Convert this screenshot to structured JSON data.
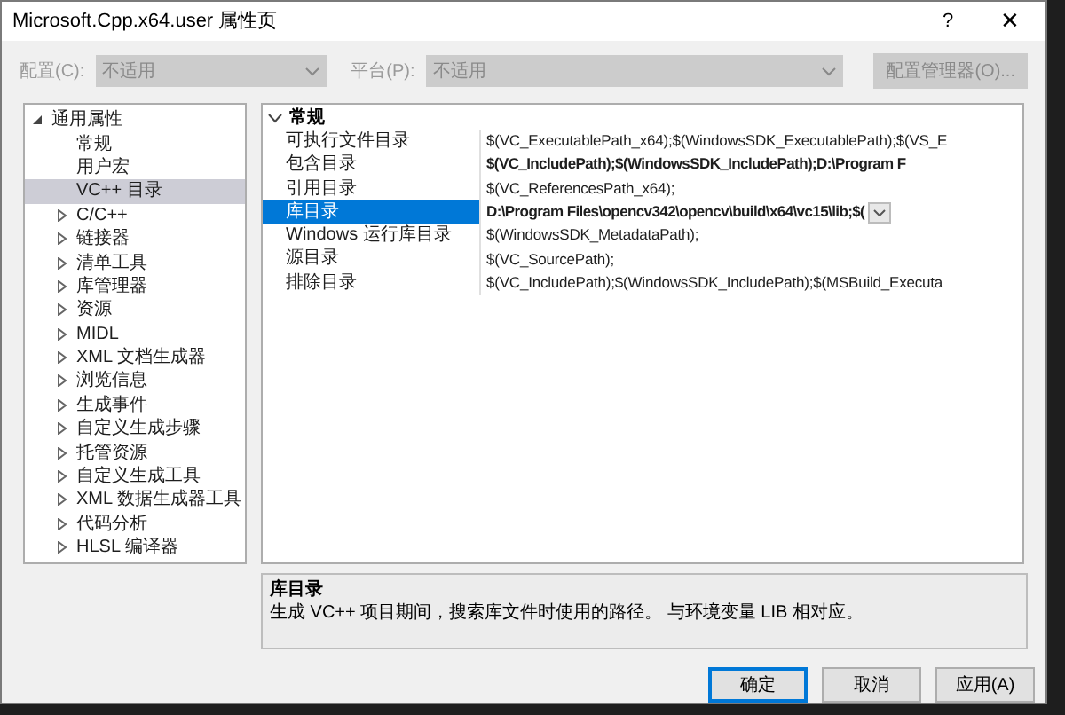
{
  "window": {
    "title": "Microsoft.Cpp.x64.user 属性页",
    "help": "?",
    "close": "✕"
  },
  "config": {
    "label": "配置(C):",
    "value": "不适用",
    "disabled": true
  },
  "platform": {
    "label": "平台(P):",
    "value": "不适用",
    "disabled": true
  },
  "config_manager_button": {
    "label": "配置管理器(O)...",
    "disabled": true
  },
  "tree": [
    {
      "label": "通用属性",
      "expanded": true,
      "selected": false,
      "children": [
        {
          "label": "常规",
          "selected": false
        },
        {
          "label": "用户宏",
          "selected": false
        },
        {
          "label": "VC++ 目录",
          "selected": true
        },
        {
          "label": "C/C++",
          "selected": false,
          "expanded": false
        },
        {
          "label": "链接器",
          "selected": false,
          "expanded": false
        },
        {
          "label": "清单工具",
          "selected": false,
          "expanded": false
        },
        {
          "label": "库管理器",
          "selected": false,
          "expanded": false
        },
        {
          "label": "资源",
          "selected": false,
          "expanded": false
        },
        {
          "label": "MIDL",
          "selected": false,
          "expanded": false
        },
        {
          "label": "XML 文档生成器",
          "selected": false,
          "expanded": false
        },
        {
          "label": "浏览信息",
          "selected": false,
          "expanded": false
        },
        {
          "label": "生成事件",
          "selected": false,
          "expanded": false
        },
        {
          "label": "自定义生成步骤",
          "selected": false,
          "expanded": false
        },
        {
          "label": "托管资源",
          "selected": false,
          "expanded": false
        },
        {
          "label": "自定义生成工具",
          "selected": false,
          "expanded": false
        },
        {
          "label": "XML 数据生成器工具",
          "selected": false,
          "expanded": false
        },
        {
          "label": "代码分析",
          "selected": false,
          "expanded": false
        },
        {
          "label": "HLSL 编译器",
          "selected": false,
          "expanded": false
        }
      ]
    }
  ],
  "property_grid": {
    "category": {
      "label": "常规",
      "expanded": true
    },
    "rows": [
      {
        "name": "可执行文件目录",
        "value": "$(VC_ExecutablePath_x64);$(WindowsSDK_ExecutablePath);$(VS_E",
        "bold": false,
        "selected": false
      },
      {
        "name": "包含目录",
        "value": "$(VC_IncludePath);$(WindowsSDK_IncludePath);D:\\Program F",
        "bold": true,
        "selected": false
      },
      {
        "name": "引用目录",
        "value": "$(VC_ReferencesPath_x64);",
        "bold": false,
        "selected": false
      },
      {
        "name": "库目录",
        "value": "D:\\Program Files\\opencv342\\opencv\\build\\x64\\vc15\\lib;$(",
        "bold": true,
        "selected": true
      },
      {
        "name": "Windows 运行库目录",
        "value": "$(WindowsSDK_MetadataPath);",
        "bold": false,
        "selected": false
      },
      {
        "name": "源目录",
        "value": "$(VC_SourcePath);",
        "bold": false,
        "selected": false
      },
      {
        "name": "排除目录",
        "value": "$(VC_IncludePath);$(WindowsSDK_IncludePath);$(MSBuild_Executa",
        "bold": false,
        "selected": false
      }
    ]
  },
  "description": {
    "title": "库目录",
    "text": "生成 VC++ 项目期间，搜索库文件时使用的路径。 与环境变量 LIB 相对应。"
  },
  "buttons": [
    {
      "label": "确定",
      "default": true
    },
    {
      "label": "取消",
      "default": false
    },
    {
      "label": "应用(A)",
      "default": false
    }
  ]
}
